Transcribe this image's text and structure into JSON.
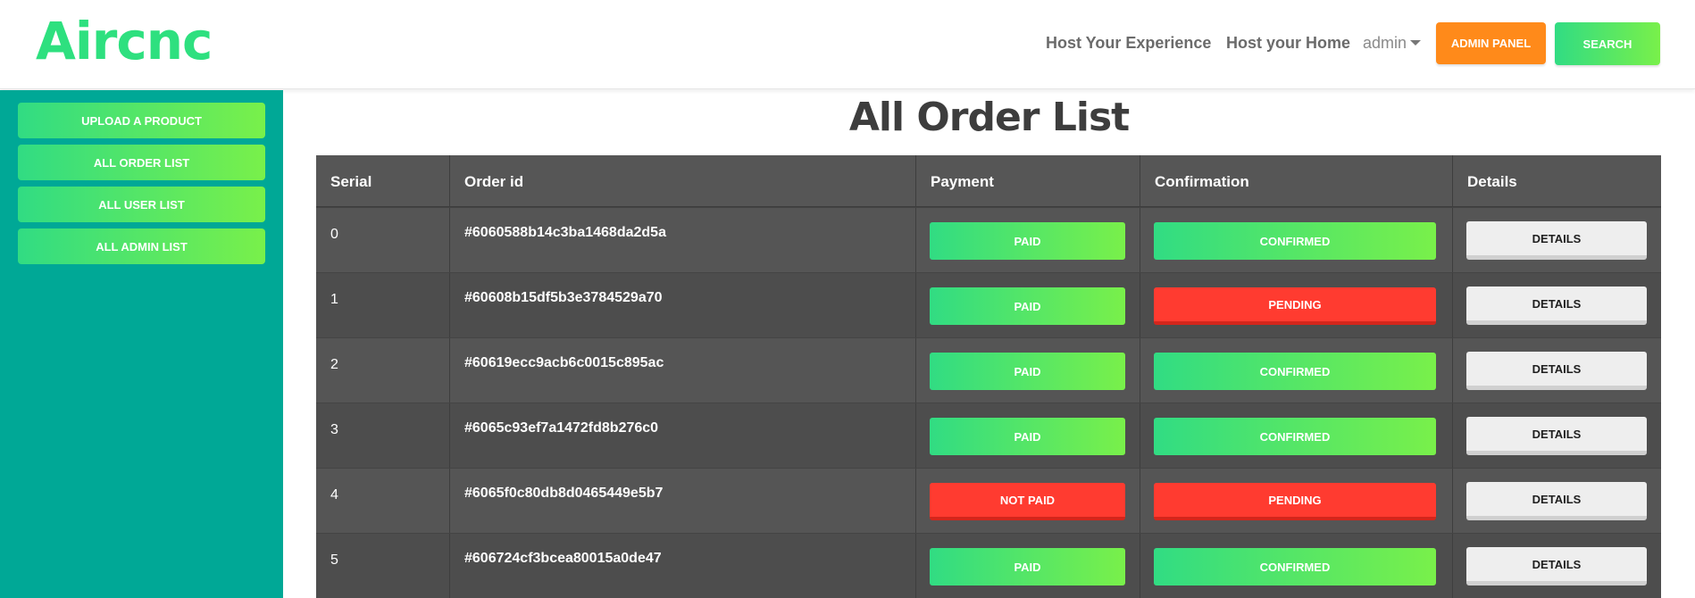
{
  "header": {
    "logo": "Aircnc",
    "nav": {
      "host_experience": "Host Your Experience",
      "host_home": "Host your Home",
      "user": "admin"
    },
    "admin_panel_label": "ADMIN PANEL",
    "search_label": "SEARCH"
  },
  "sidebar": {
    "items": [
      {
        "label": "UPLOAD A PRODUCT"
      },
      {
        "label": "ALL ORDER LIST"
      },
      {
        "label": "ALL USER LIST"
      },
      {
        "label": "ALL ADMIN LIST"
      }
    ]
  },
  "main": {
    "title": "All Order List",
    "table": {
      "columns": [
        "Serial",
        "Order id",
        "Payment",
        "Confirmation",
        "Details"
      ],
      "rows": [
        {
          "serial": "0",
          "order_id": "#6060588b14c3ba1468da2d5a",
          "payment": "PAID",
          "confirmation": "CONFIRMED",
          "details": "DETAILS"
        },
        {
          "serial": "1",
          "order_id": "#60608b15df5b3e3784529a70",
          "payment": "PAID",
          "confirmation": "PENDING",
          "details": "DETAILS"
        },
        {
          "serial": "2",
          "order_id": "#60619ecc9acb6c0015c895ac",
          "payment": "PAID",
          "confirmation": "CONFIRMED",
          "details": "DETAILS"
        },
        {
          "serial": "3",
          "order_id": "#6065c93ef7a1472fd8b276c0",
          "payment": "PAID",
          "confirmation": "CONFIRMED",
          "details": "DETAILS"
        },
        {
          "serial": "4",
          "order_id": "#6065f0c80db8d0465449e5b7",
          "payment": "NOT PAID",
          "confirmation": "PENDING",
          "details": "DETAILS"
        },
        {
          "serial": "5",
          "order_id": "#606724cf3bcea80015a0de47",
          "payment": "PAID",
          "confirmation": "CONFIRMED",
          "details": "DETAILS"
        }
      ]
    }
  },
  "colors": {
    "brand_green": "#2ee07f",
    "sidebar_teal": "#00a896",
    "admin_orange": "#ff8a1a",
    "status_red": "#ff3b30",
    "gradient_start": "#31dc83",
    "gradient_end": "#79f04a"
  }
}
